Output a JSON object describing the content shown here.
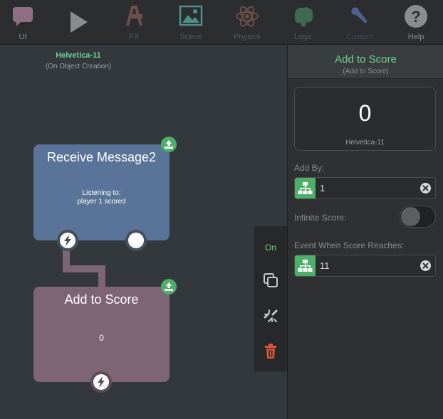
{
  "toolbar": {
    "items": [
      {
        "label": "UI",
        "icon": "speech-bubble-icon"
      },
      {
        "label": "",
        "icon": "play-icon"
      },
      {
        "label": "FX",
        "icon": "fx-icon"
      },
      {
        "label": "Scene",
        "icon": "scene-image-icon"
      },
      {
        "label": "Physics",
        "icon": "atom-icon"
      },
      {
        "label": "Logic",
        "icon": "brain-icon"
      },
      {
        "label": "Custom",
        "icon": "wrench-icon"
      },
      {
        "label": "Help",
        "icon": "help-icon"
      }
    ]
  },
  "canvas": {
    "object_name": "Helvetica-11",
    "object_trigger": "(On Object Creation)",
    "receive_node": {
      "title": "Receive Message2",
      "line1": "Listening to:",
      "line2": "player 1 scored"
    },
    "score_node": {
      "title": "Add to Score",
      "value": "0"
    }
  },
  "side_menu": {
    "on_label": "On"
  },
  "panel": {
    "title": "Add to Score",
    "subtitle": "(Add to Score)",
    "score_value": "0",
    "score_object": "Helvetica-11",
    "add_by_label": "Add By:",
    "add_by_value": "1",
    "infinite_label": "Infinite Score:",
    "event_label": "Event When Score Reaches:",
    "event_value": "11"
  },
  "colors": {
    "accent_green": "#6fd38f",
    "badge_green": "#4caf6a",
    "receive_node": "#5a7398",
    "score_node": "#7d6574",
    "delete_red": "#e0533a"
  }
}
